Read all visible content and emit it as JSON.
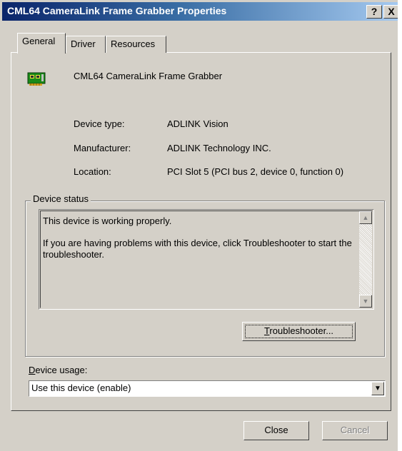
{
  "window": {
    "title": "CML64 CameraLink Frame Grabber Properties",
    "help_label": "?",
    "close_label": "X"
  },
  "tabs": [
    {
      "label": "General",
      "active": true
    },
    {
      "label": "Driver",
      "active": false
    },
    {
      "label": "Resources",
      "active": false
    }
  ],
  "device": {
    "name": "CML64 CameraLink Frame Grabber",
    "icon": "pci-card-icon",
    "properties": [
      {
        "label": "Device type:",
        "value": "ADLINK Vision"
      },
      {
        "label": "Manufacturer:",
        "value": "ADLINK Technology INC."
      },
      {
        "label": "Location:",
        "value": "PCI Slot 5 (PCI bus 2, device 0, function 0)"
      }
    ]
  },
  "status": {
    "group_title": "Device status",
    "line1": "This device is working properly.",
    "line2": "If you are having problems with this device, click Troubleshooter to start the troubleshooter.",
    "troubleshooter_label": "Troubleshooter..."
  },
  "usage": {
    "label": "Device usage:",
    "selected": "Use this device (enable)"
  },
  "footer": {
    "close_label": "Close",
    "cancel_label": "Cancel"
  },
  "colors": {
    "title_start": "#0a246a",
    "title_end": "#a6caf0",
    "face": "#d4d0c8"
  }
}
